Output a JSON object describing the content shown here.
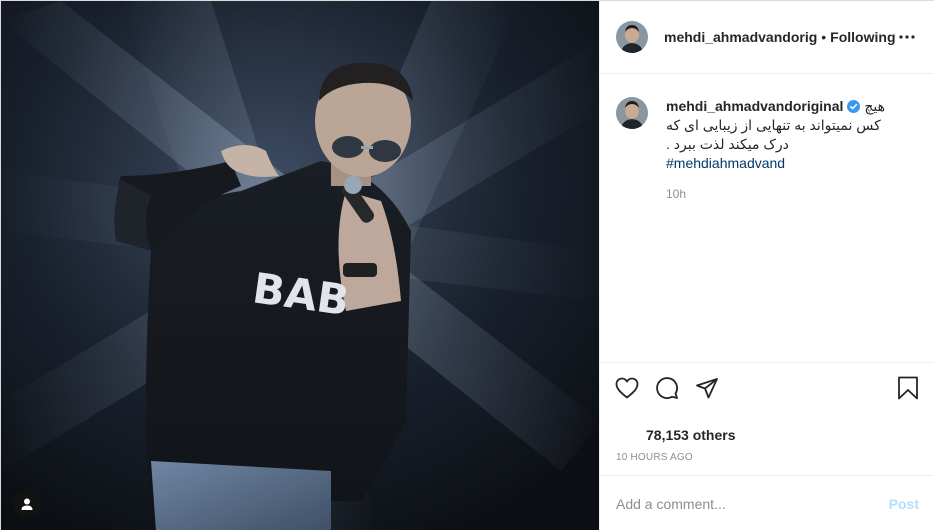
{
  "post": {
    "header": {
      "username": "mehdi_ahmadvandorig",
      "separator": "•",
      "follow_status": "Following",
      "more_icon": "more-horizontal-icon"
    },
    "caption": {
      "username": "mehdi_ahmadvandoriginal",
      "verified": true,
      "first_word": "هیچ",
      "text_line2": "کس نمیتواند به تنهایی از زیبایی ای که",
      "text_line3": "درک میکند لذت ببرد .",
      "hashtag": "#mehdiahmadvand",
      "time": "10h"
    },
    "actions": {
      "like_icon": "heart-icon",
      "comment_icon": "comment-icon",
      "share_icon": "share-icon",
      "save_icon": "bookmark-icon"
    },
    "likes_text": "78,153 others",
    "posted_ago": "10 HOURS AGO",
    "comment": {
      "placeholder": "Add a comment...",
      "post_label": "Post"
    },
    "photo": {
      "user_tag_icon": "user-tag-icon"
    }
  },
  "colors": {
    "verified": "#3897f0",
    "hashtag": "#00376b",
    "muted": "#8e8e8e",
    "post_button_disabled": "#b2dffc"
  }
}
